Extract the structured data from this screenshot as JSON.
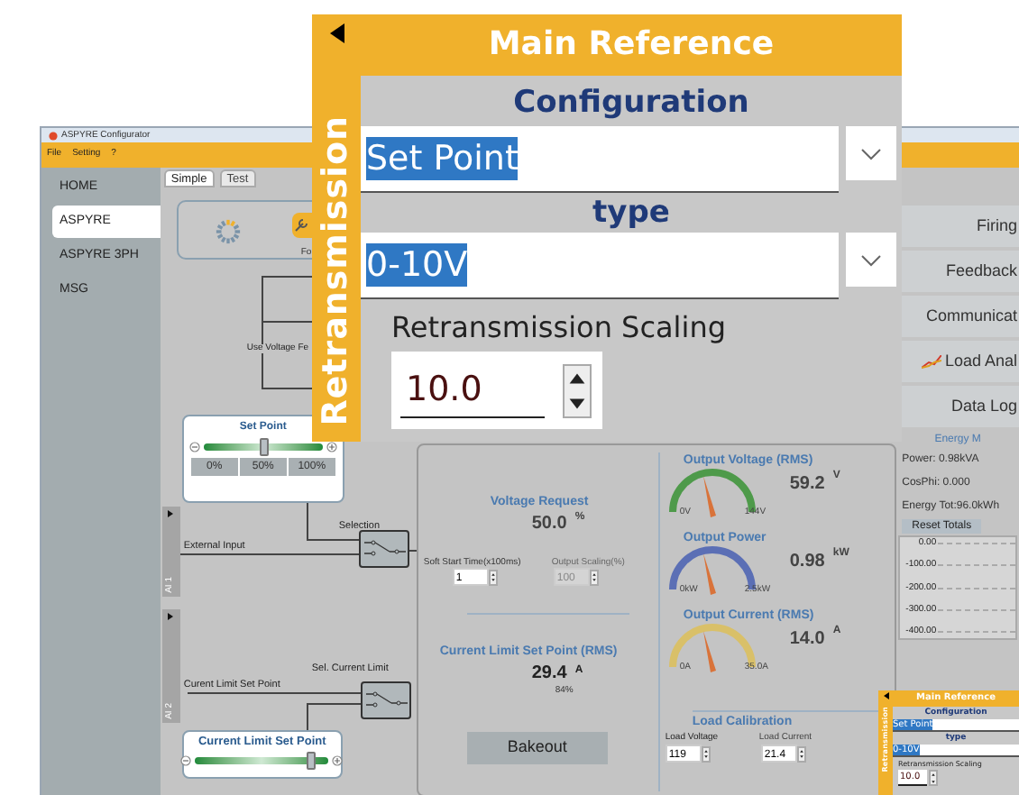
{
  "window": {
    "title": "ASPYRE Configurator"
  },
  "menu": [
    "File",
    "Setting",
    "?"
  ],
  "sidebar": [
    {
      "label": "HOME",
      "selected": false
    },
    {
      "label": "ASPYRE",
      "selected": true
    },
    {
      "label": "ASPYRE 3PH",
      "selected": false
    },
    {
      "label": "MSG",
      "selected": false
    }
  ],
  "tabs": [
    {
      "label": "Simple",
      "selected": true
    },
    {
      "label": "Test",
      "selected": false
    }
  ],
  "toolbar": {
    "button_label": "Fo"
  },
  "diagram": {
    "feedback_label": "Use Voltage Fe",
    "set_point": {
      "title": "Set Point",
      "level": 0.5,
      "buttons": [
        "0%",
        "50%",
        "100%"
      ]
    },
    "ai1": {
      "label": "AI 1",
      "input": "External Input",
      "selector": "Selection"
    },
    "ai2": {
      "label": "AI 2",
      "selector": "Sel. Current Limit",
      "input": "Curent Limit Set Point"
    },
    "current_limit": {
      "title": "Current Limit Set Point",
      "level": 0.86
    }
  },
  "panel": {
    "voltage_request": {
      "title": "Voltage Request",
      "value": "50.0",
      "unit": "%"
    },
    "soft_start": {
      "label": "Soft Start Time(x100ms)",
      "value": "1"
    },
    "output_scaling": {
      "label": "Output Scaling(%)",
      "value": "100",
      "disabled": true
    },
    "current_limit": {
      "title": "Current Limit Set Point (RMS)",
      "value": "29.4",
      "unit": "A",
      "percent": "84%"
    },
    "bakeout": "Bakeout",
    "gauges": [
      {
        "title": "Output Voltage (RMS)",
        "min": "0V",
        "max": "144V",
        "value": "59.2",
        "unit": "V",
        "color": "#4e9a4a"
      },
      {
        "title": "Output Power",
        "min": "0kW",
        "max": "2.5kW",
        "value": "0.98",
        "unit": "kW",
        "color": "#5b6fb5"
      },
      {
        "title": "Output Current (RMS)",
        "min": "0A",
        "max": "35.0A",
        "value": "14.0",
        "unit": "A",
        "color": "#d9c069"
      }
    ],
    "load_calibration": {
      "title": "Load Calibration",
      "voltage_label": "Load Voltage",
      "voltage": "119",
      "current_label": "Load Current",
      "current": "21.4"
    }
  },
  "right_menu": [
    "Firing",
    "Feedback",
    "Communicat",
    "Load Anal",
    "Data Log"
  ],
  "energy": {
    "title": "Energy M",
    "lines": [
      "Power: 0.98kVA",
      "CosPhi: 0.000",
      "Energy Tot:96.0kWh"
    ],
    "reset": "Reset Totals",
    "axis_labels": [
      "0.00",
      "-100.00",
      "-200.00",
      "-300.00",
      "-400.00"
    ]
  },
  "callout": {
    "side_label": "Retransmission",
    "title": "Main Reference",
    "configuration_label": "Configuration",
    "configuration": "Set Point",
    "type_label": "type",
    "type": "0-10V",
    "scaling_label": "Retransmission Scaling",
    "scaling": "10.0"
  },
  "mini_callout": {
    "side_label": "Retransmission",
    "title": "Main Reference",
    "configuration_label": "Configuration",
    "configuration": "Set Point",
    "type_label": "type",
    "type": "0-10V",
    "scaling_label": "Retransmission Scaling",
    "scaling": "10.0"
  }
}
